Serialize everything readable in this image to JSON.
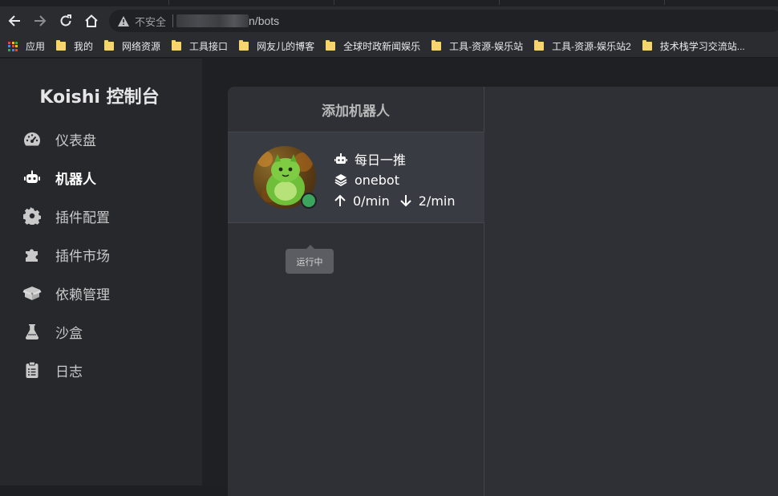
{
  "browser": {
    "address": {
      "security_label": "不安全",
      "url_path": "n/bots"
    },
    "bookmarks": [
      {
        "label": "应用",
        "type": "apps"
      },
      {
        "label": "我的",
        "type": "folder"
      },
      {
        "label": "网络资源",
        "type": "folder"
      },
      {
        "label": "工具接口",
        "type": "folder"
      },
      {
        "label": "网友儿的博客",
        "type": "folder"
      },
      {
        "label": "全球时政新闻娱乐",
        "type": "folder"
      },
      {
        "label": "工具-资源-娱乐站",
        "type": "folder"
      },
      {
        "label": "工具-资源-娱乐站2",
        "type": "folder"
      },
      {
        "label": "技术栈学习交流站...",
        "type": "folder"
      }
    ],
    "apps_colors": [
      "#e94335",
      "#fbbc05",
      "#34a853",
      "#4285f4",
      "#e94335",
      "#fbbc05",
      "#34a853",
      "#4285f4",
      "#e94335"
    ]
  },
  "sidebar": {
    "brand": "Koishi 控制台",
    "items": [
      {
        "label": "仪表盘",
        "icon": "dashboard-icon",
        "active": false
      },
      {
        "label": "机器人",
        "icon": "robot-icon",
        "active": true
      },
      {
        "label": "插件配置",
        "icon": "gear-icon",
        "active": false
      },
      {
        "label": "插件市场",
        "icon": "puzzle-icon",
        "active": false
      },
      {
        "label": "依赖管理",
        "icon": "box-icon",
        "active": false
      },
      {
        "label": "沙盒",
        "icon": "flask-icon",
        "active": false
      },
      {
        "label": "日志",
        "icon": "clipboard-icon",
        "active": false
      }
    ]
  },
  "main": {
    "add_bot_label": "添加机器人",
    "bot": {
      "name": "每日一推",
      "platform": "onebot",
      "sent_rate": "0/min",
      "received_rate": "2/min",
      "status_tooltip": "运行中",
      "status_color": "#3ba55d"
    }
  }
}
